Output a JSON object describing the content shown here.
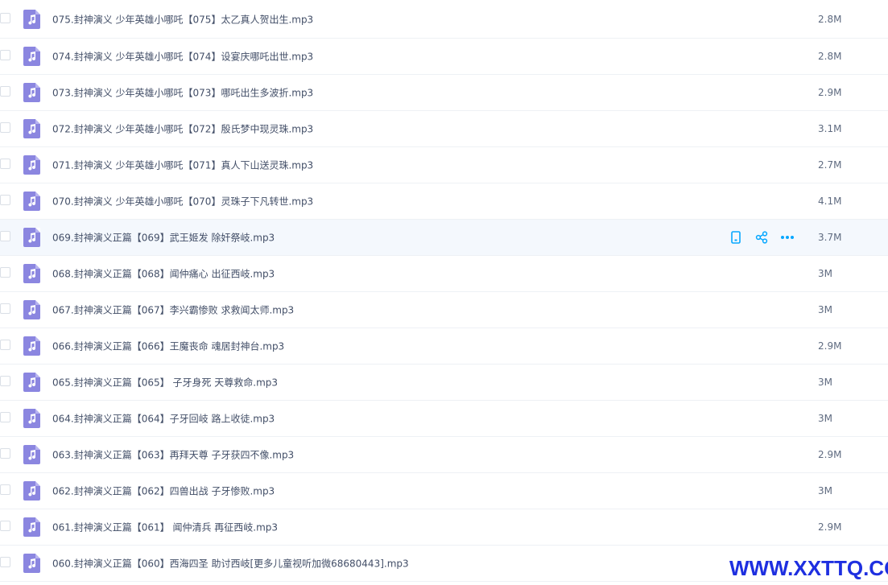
{
  "files": [
    {
      "name": "075.封神演义 少年英雄小哪吒【075】太乙真人贺出生.mp3",
      "size": "2.8M"
    },
    {
      "name": "074.封神演义 少年英雄小哪吒【074】设宴庆哪吒出世.mp3",
      "size": "2.8M"
    },
    {
      "name": "073.封神演义 少年英雄小哪吒【073】哪吒出生多波折.mp3",
      "size": "2.9M"
    },
    {
      "name": "072.封神演义 少年英雄小哪吒【072】殷氏梦中现灵珠.mp3",
      "size": "3.1M"
    },
    {
      "name": "071.封神演义 少年英雄小哪吒【071】真人下山送灵珠.mp3",
      "size": "2.7M"
    },
    {
      "name": "070.封神演义 少年英雄小哪吒【070】灵珠子下凡转世.mp3",
      "size": "4.1M"
    },
    {
      "name": "069.封神演义正篇【069】武王姬发 除奸祭岐.mp3",
      "size": "3.7M"
    },
    {
      "name": "068.封神演义正篇【068】闻仲痛心 出征西岐.mp3",
      "size": "3M"
    },
    {
      "name": "067.封神演义正篇【067】李兴霸惨败 求救闻太师.mp3",
      "size": "3M"
    },
    {
      "name": "066.封神演义正篇【066】王魔丧命 魂居封神台.mp3",
      "size": "2.9M"
    },
    {
      "name": "065.封神演义正篇【065】 子牙身死 天尊救命.mp3",
      "size": "3M"
    },
    {
      "name": "064.封神演义正篇【064】子牙回岐 路上收徒.mp3",
      "size": "3M"
    },
    {
      "name": "063.封神演义正篇【063】再拜天尊 子牙获四不像.mp3",
      "size": "2.9M"
    },
    {
      "name": "062.封神演义正篇【062】四兽出战 子牙惨败.mp3",
      "size": "3M"
    },
    {
      "name": "061.封神演义正篇【061】 闻仲清兵 再征西岐.mp3",
      "size": "2.9M"
    },
    {
      "name": "060.封神演义正篇【060】西海四圣 助讨西岐[更多儿童视听加微68680443].mp3",
      "size": ""
    }
  ],
  "hover_actions": {
    "icons": [
      "phone-icon",
      "share-icon",
      "more-icon"
    ],
    "accent_color": "#06a7ff"
  },
  "watermark": "WWW.XXTTQ.COM",
  "colors": {
    "file_icon": "#8b86e0",
    "hover_row_bg": "#f4f8fd",
    "watermark": "#1e2fe0"
  }
}
